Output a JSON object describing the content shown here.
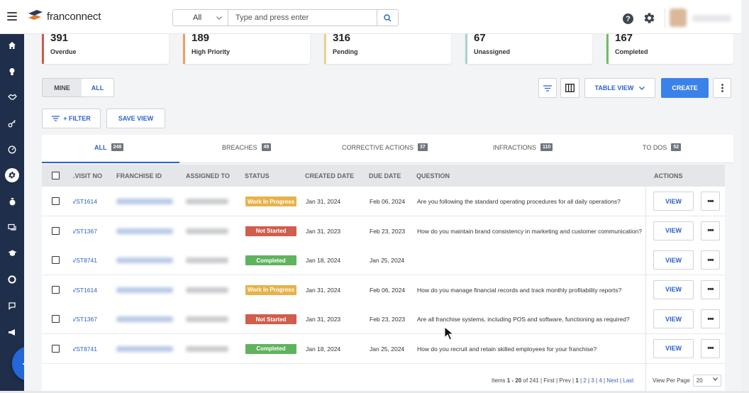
{
  "topbar": {
    "logo_text": "franconnect",
    "search": {
      "scope": "All",
      "placeholder": "Type and press enter"
    },
    "help_label": "?"
  },
  "summary_cards": [
    {
      "value": "391",
      "label": "Overdue",
      "color": "#d05b4b"
    },
    {
      "value": "189",
      "label": "High Priority",
      "color": "#e9a064"
    },
    {
      "value": "316",
      "label": "Pending",
      "color": "#eed08a"
    },
    {
      "value": "67",
      "label": "Unassigned",
      "color": "#a8d4cc"
    },
    {
      "value": "167",
      "label": "Completed",
      "color": "#6dbd63"
    }
  ],
  "toggle": {
    "mine": "MINE",
    "all": "ALL"
  },
  "toolbar": {
    "table_view": "TABLE VIEW",
    "create": "CREATE",
    "filter": "+ FILTER",
    "save_view": "SAVE VIEW"
  },
  "tabs": [
    {
      "label": "ALL",
      "count": "248"
    },
    {
      "label": "BREACHES",
      "count": "49"
    },
    {
      "label": "CORRECTIVE ACTIONS",
      "count": "37"
    },
    {
      "label": "INFRACTIONS",
      "count": "110"
    },
    {
      "label": "TO DOS",
      "count": "52"
    }
  ],
  "columns": {
    "visit_no": "VISIT NO.",
    "franchise_id": "FRANCHISE ID",
    "assigned_to": "ASSIGNED TO",
    "status": "STATUS",
    "created_date": "CREATED DATE",
    "due_date": "DUE DATE",
    "question": "QUESTION",
    "actions": "ACTIONS"
  },
  "status_colors": {
    "Work In Progress": "#e8b24a",
    "Not Started": "#d15d4c",
    "Completed": "#5fb35d"
  },
  "rows": [
    {
      "visit": "VST1614",
      "status": "Work In Progress",
      "created": "Jan 31, 2024",
      "due": "Feb 06, 2024",
      "question": "Are you following the standard operating procedures for all daily operations?"
    },
    {
      "visit": "VST1367",
      "status": "Not Started",
      "created": "Jan 31, 2023",
      "due": "Feb 23, 2023",
      "question": "How do you maintain brand consistency in marketing and customer communication?"
    },
    {
      "visit": "VST8741",
      "status": "Completed",
      "created": "Jan 18, 2024",
      "due": "Jan 25, 2024",
      "question": ""
    },
    {
      "visit": "VST1614",
      "status": "Work In Progress",
      "created": "Jan 31, 2024",
      "due": "Feb 06, 2024",
      "question": "How do you manage financial records and track monthly profitability reports?"
    },
    {
      "visit": "VST1367",
      "status": "Not Started",
      "created": "Jan 31, 2023",
      "due": "Feb 23, 2023",
      "question": "Are all franchise systems, including POS and software, functioning as required?"
    },
    {
      "visit": "VST8741",
      "status": "Completed",
      "created": "Jan 18, 2024",
      "due": "Jan 25, 2024",
      "question": "How do you recruit and retain skilled employees for your franchise?"
    }
  ],
  "actions": {
    "view": "VIEW",
    "more": "•••"
  },
  "pagination": {
    "items_prefix": "Items",
    "range": "1 - 20",
    "of_total": "of 241",
    "first": "First",
    "prev": "Prev",
    "pages": [
      "1",
      "2",
      "3",
      "4"
    ],
    "next": "Next",
    "last": "Last",
    "view_per_page_label": "View Per Page",
    "per_page": "20"
  }
}
